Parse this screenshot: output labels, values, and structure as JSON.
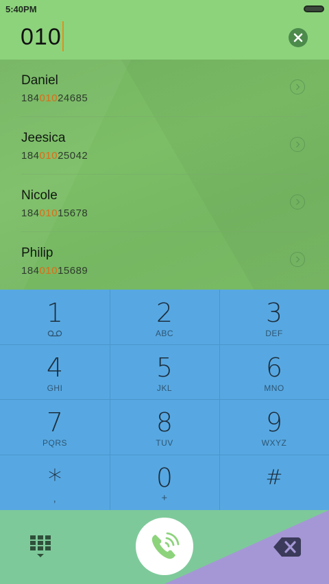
{
  "status_bar": {
    "time": "5:40PM"
  },
  "dialer": {
    "input_value": "010"
  },
  "contacts": [
    {
      "name": "Daniel",
      "number_prefix": "184",
      "number_match": "010",
      "number_suffix": "24685"
    },
    {
      "name": "Jeesica",
      "number_prefix": "184",
      "number_match": "010",
      "number_suffix": "25042"
    },
    {
      "name": "Nicole",
      "number_prefix": "184",
      "number_match": "010",
      "number_suffix": "15678"
    },
    {
      "name": "Philip",
      "number_prefix": "184",
      "number_match": "010",
      "number_suffix": "15689"
    }
  ],
  "keypad": [
    {
      "digit": "1",
      "letters": "",
      "icon": "voicemail-icon"
    },
    {
      "digit": "2",
      "letters": "ABC"
    },
    {
      "digit": "3",
      "letters": "DEF"
    },
    {
      "digit": "4",
      "letters": "GHI"
    },
    {
      "digit": "5",
      "letters": "JKL"
    },
    {
      "digit": "6",
      "letters": "MNO"
    },
    {
      "digit": "7",
      "letters": "PQRS"
    },
    {
      "digit": "8",
      "letters": "TUV"
    },
    {
      "digit": "9",
      "letters": "WXYZ"
    },
    {
      "digit": "*",
      "letters": ","
    },
    {
      "digit": "0",
      "letters": "+"
    },
    {
      "digit": "#",
      "letters": ""
    }
  ],
  "colors": {
    "header": "#8dd37c",
    "list_background": "#78b964",
    "match_highlight": "#e06a16",
    "keypad": "#57a8e2",
    "action_bar_green": "#7ec99a",
    "action_bar_purple": "#a597d6",
    "call_icon": "#8dd37c"
  },
  "icons": {
    "clear": "clear-circle-icon",
    "row_arrow": "chevron-right-circle-icon",
    "dialpad": "dialpad-toggle-icon",
    "call": "phone-call-icon",
    "backspace": "backspace-icon"
  }
}
